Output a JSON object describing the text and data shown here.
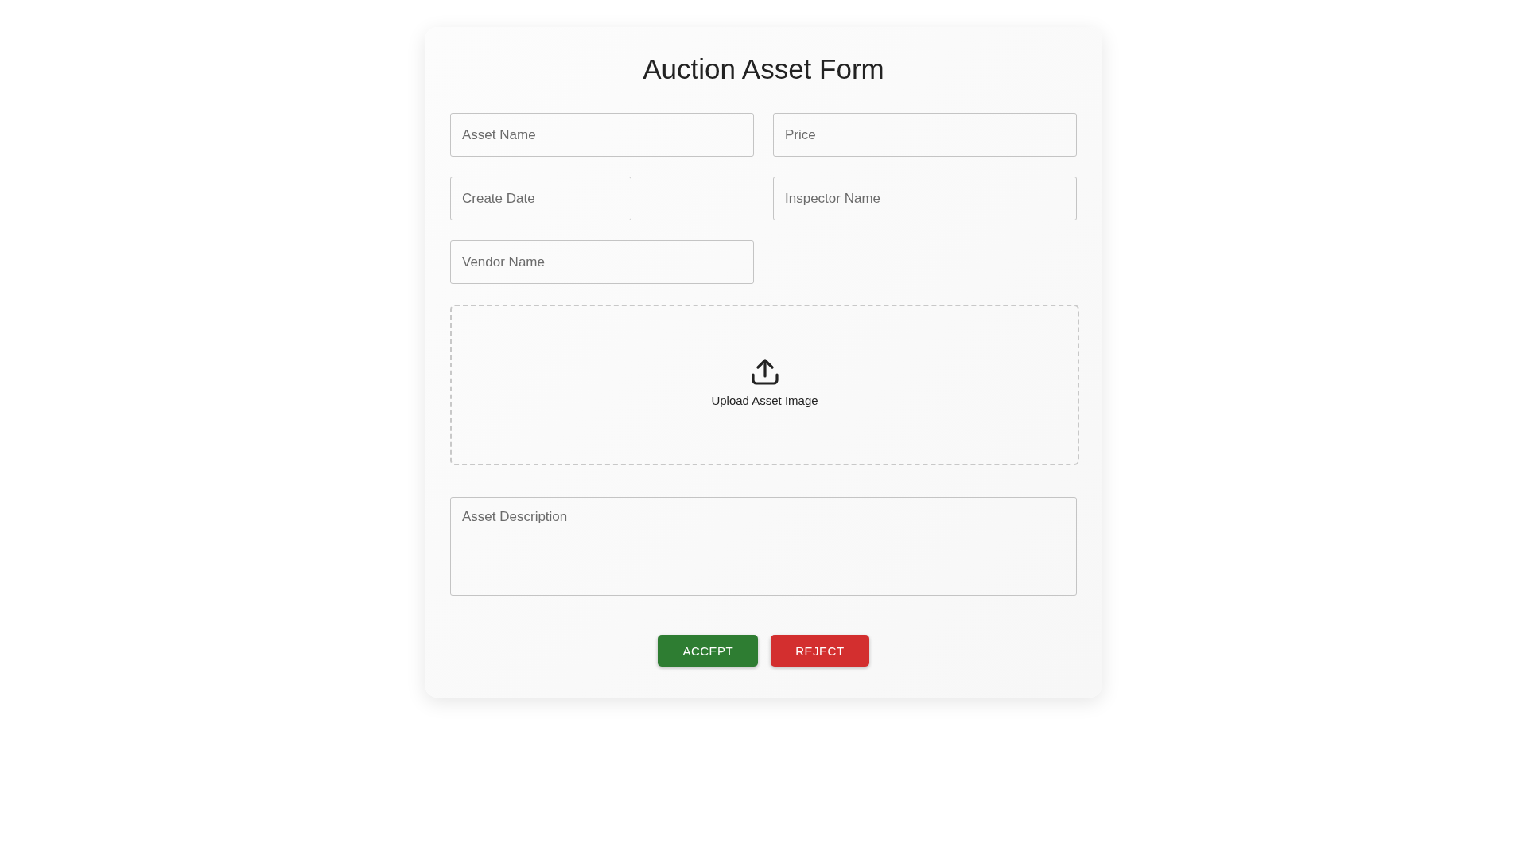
{
  "title": "Auction Asset Form",
  "fields": [
    {
      "kind": "text",
      "placeholder": "Asset Name"
    },
    {
      "kind": "text",
      "placeholder": "Price"
    },
    {
      "kind": "date",
      "placeholder": "Create Date"
    },
    {
      "kind": "text",
      "placeholder": "Inspector Name"
    },
    {
      "kind": "text",
      "placeholder": "Vendor Name"
    }
  ],
  "upload": {
    "label": "Upload Asset Image"
  },
  "description": {
    "placeholder": "Asset Description"
  },
  "buttons": [
    {
      "kind": "accept",
      "label": "ACCEPT"
    },
    {
      "kind": "reject",
      "label": "REJECT"
    }
  ]
}
